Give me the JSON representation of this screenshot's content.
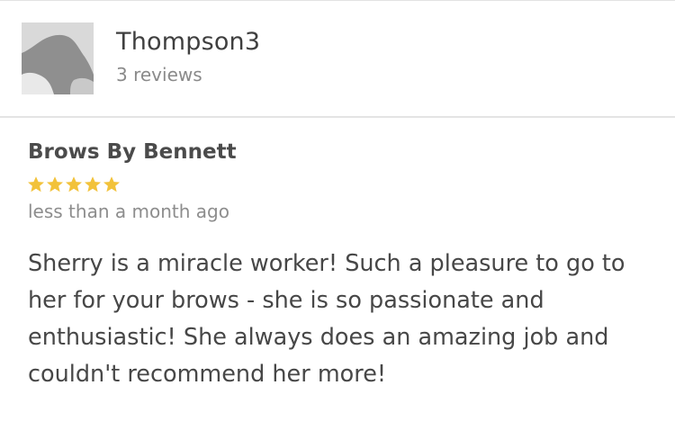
{
  "user": {
    "name": "Thompson3",
    "review_count": "3 reviews",
    "avatar_icon": "default-user-avatar-icon"
  },
  "review": {
    "business_name": "Brows By Bennett",
    "rating": 5,
    "rating_max": 5,
    "date": "less than a month ago",
    "text": "Sherry is a miracle worker! Such a pleasure to go to her for your brows - she is so passionate and enthusiastic! She always does an amazing job and couldn't recommend her more!"
  },
  "colors": {
    "star": "#f2c23a",
    "avatar_bg": "#d7d7d7",
    "avatar_figure": "#8f8f8f",
    "divider": "#e4e4e4"
  }
}
